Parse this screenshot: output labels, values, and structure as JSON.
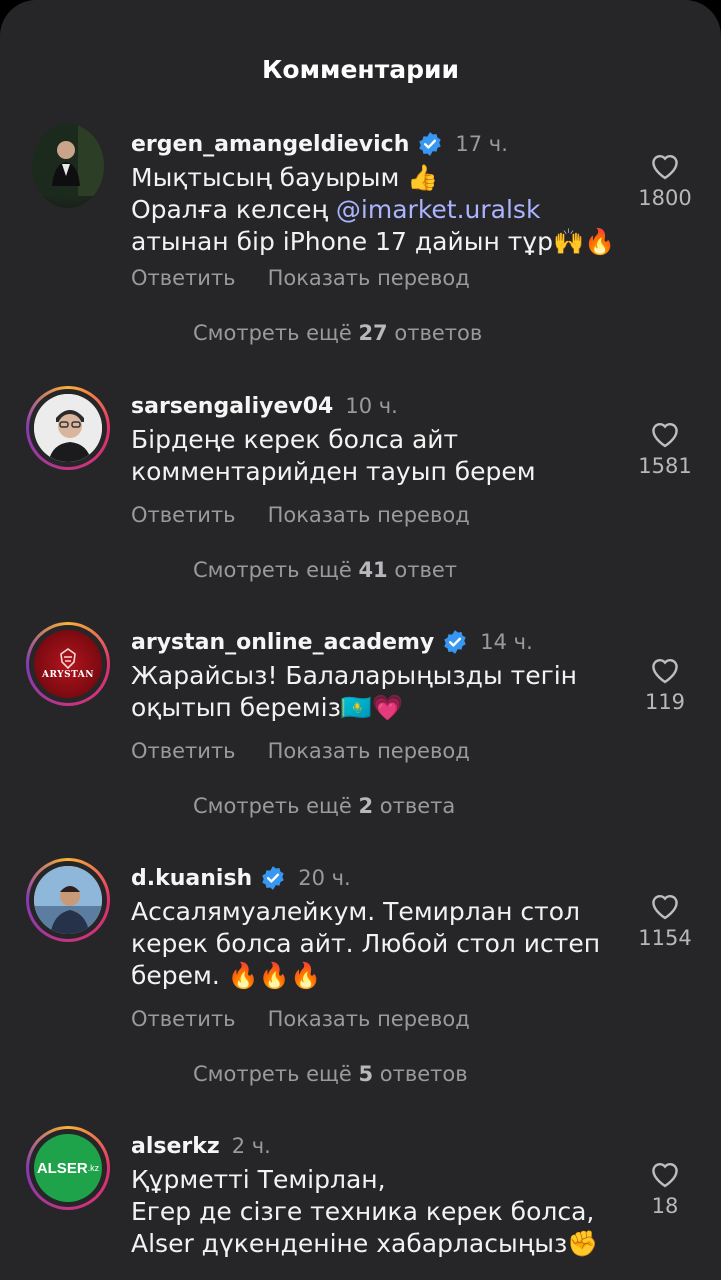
{
  "header": {
    "title": "Комментарии"
  },
  "comments": [
    {
      "username": "ergen_amangeldievich",
      "verified": true,
      "time": "17 ч.",
      "lines": [
        "Мықтысың бауырым 👍",
        "Оралға келсең ",
        "атынан бір iPhone 17 дайын тұр🙌🔥"
      ],
      "mention": "@imarket.uralsk",
      "reply": "Ответить",
      "translate": "Показать перевод",
      "more_prefix": "Смотреть ещё",
      "more_count": "27",
      "more_suffix": "ответов",
      "likes": "1800"
    },
    {
      "username": "sarsengaliyev04",
      "verified": false,
      "time": "10 ч.",
      "lines": [
        "Бірдеңе керек болса айт",
        "комментарийден тауып берем"
      ],
      "reply": "Ответить",
      "translate": "Показать перевод",
      "more_prefix": "Смотреть ещё",
      "more_count": "41",
      "more_suffix": "ответ",
      "likes": "1581"
    },
    {
      "username": "arystan_online_academy",
      "verified": true,
      "time": "14 ч.",
      "lines": [
        "Жарайсыз! Балаларыңызды тегін",
        "оқытып береміз🇰🇿💗"
      ],
      "avatar_text": "ARYSTAN",
      "reply": "Ответить",
      "translate": "Показать перевод",
      "more_prefix": "Смотреть ещё",
      "more_count": "2",
      "more_suffix": "ответа",
      "likes": "119"
    },
    {
      "username": "d.kuanish",
      "verified": true,
      "time": "20 ч.",
      "lines": [
        "Ассалямуалейкум. Темирлан стол",
        "керек болса айт. Любой стол истеп",
        "берем. 🔥🔥🔥"
      ],
      "reply": "Ответить",
      "translate": "Показать перевод",
      "more_prefix": "Смотреть ещё",
      "more_count": "5",
      "more_suffix": "ответов",
      "likes": "1154"
    },
    {
      "username": "alserkz",
      "verified": false,
      "time": "2 ч.",
      "lines": [
        "Құрметті Темірлан,",
        "Егер де сізге техника керек болса,",
        "Alser дүкенденіне хабарласыңыз✊"
      ],
      "avatar_text": "ALSER",
      "avatar_sub": ".kz",
      "likes": "18"
    }
  ],
  "colors": {
    "background": "#262628",
    "verified": "#3897f0",
    "mention": "#aab4ff",
    "muted": "#9a9a9e"
  },
  "icons": {
    "like": "heart-outline-icon",
    "verified": "verified-badge-icon"
  }
}
